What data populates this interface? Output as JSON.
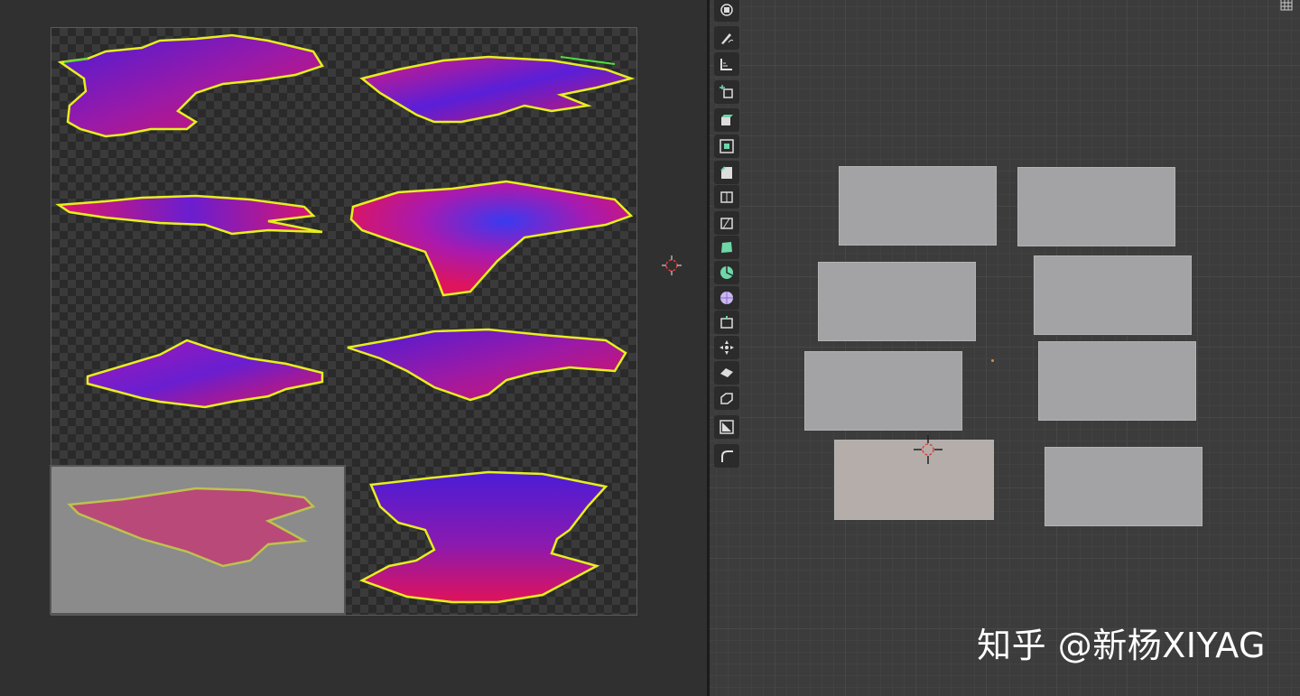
{
  "watermark": "知乎 @新杨XIYAG",
  "uv_editor": {
    "tiles": [
      {
        "name": "texture-tile-1"
      },
      {
        "name": "texture-tile-2"
      },
      {
        "name": "texture-tile-3"
      },
      {
        "name": "texture-tile-4"
      },
      {
        "name": "texture-tile-5"
      },
      {
        "name": "texture-tile-6"
      },
      {
        "name": "texture-tile-7",
        "selected": true
      },
      {
        "name": "texture-tile-8"
      }
    ]
  },
  "toolbar": {
    "tools": [
      "view-pivot-icon",
      "annotate-icon",
      "measure-icon",
      "add-cube-icon",
      "extrude-icon",
      "inset-icon",
      "bevel-icon",
      "loop-cut-icon",
      "knife-icon",
      "poly-build-icon",
      "spin-icon",
      "smooth-icon",
      "edge-slide-icon",
      "shrink-fatten-icon",
      "shear-icon",
      "rip-icon",
      "uv-mask-icon",
      "curve-icon"
    ]
  },
  "viewport": {
    "planes": 8,
    "active_plane": 7
  },
  "colors": {
    "background": "#303030",
    "viewport": "#3c3c3c",
    "plane": "#a3a3a5",
    "active_plane": "#b4adaa",
    "texture_magenta": "#e0146a",
    "texture_purple": "#5a1fd8",
    "texture_yellow": "#e6ef1e"
  }
}
